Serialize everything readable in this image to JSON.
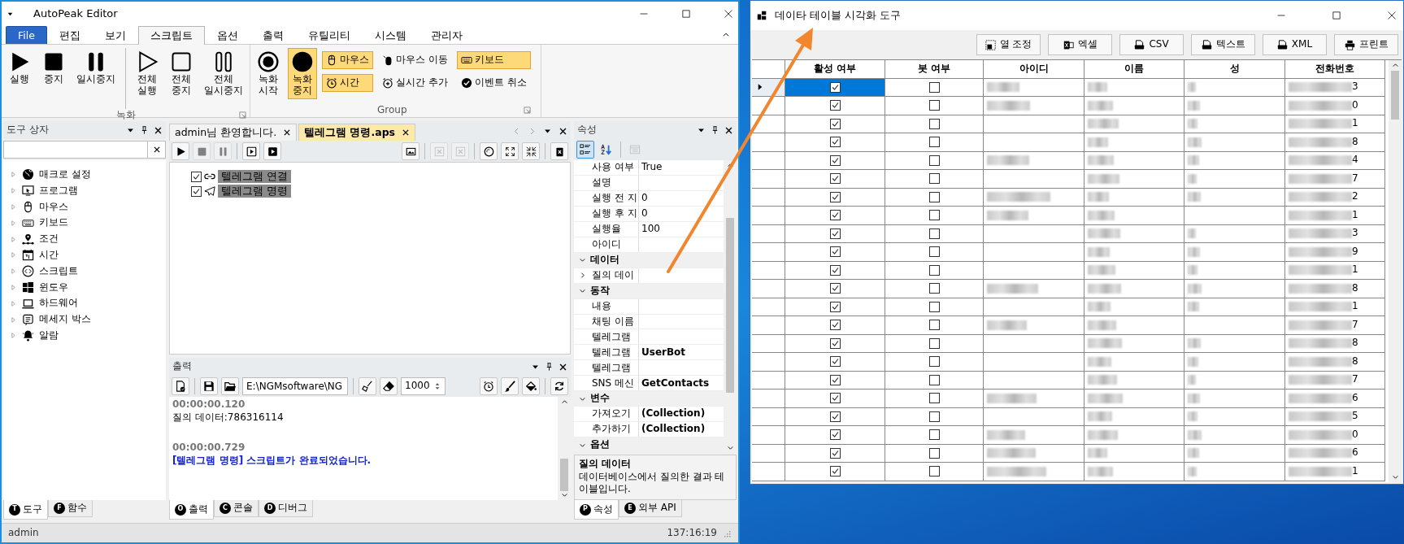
{
  "editor": {
    "title": "AutoPeak Editor",
    "menu_tabs": [
      {
        "label": "File",
        "kind": "file",
        "selected": false
      },
      {
        "label": "편집",
        "kind": "tab",
        "selected": false
      },
      {
        "label": "보기",
        "kind": "tab",
        "selected": false
      },
      {
        "label": "스크립트",
        "kind": "tab",
        "selected": true
      },
      {
        "label": "옵션",
        "kind": "tab",
        "selected": false
      },
      {
        "label": "출력",
        "kind": "tab",
        "selected": false
      },
      {
        "label": "유틸리티",
        "kind": "tab",
        "selected": false
      },
      {
        "label": "시스템",
        "kind": "tab",
        "selected": false
      },
      {
        "label": "관리자",
        "kind": "tab",
        "selected": false
      }
    ],
    "ribbon_groups": [
      {
        "label": "녹화",
        "buttons": [
          {
            "label": "실행",
            "on": false
          },
          {
            "label": "중지",
            "on": false
          },
          {
            "label": "일시중지",
            "on": false
          },
          {
            "label": "전체 실행",
            "on": false
          },
          {
            "label": "전체 중지",
            "on": false
          },
          {
            "label": "전체 일시중지",
            "on": false
          }
        ]
      },
      {
        "label": "Group",
        "buttons": [
          {
            "label": "녹화 시작",
            "on": false
          },
          {
            "label": "녹화 중지",
            "on": true
          }
        ],
        "small_buttons": [
          {
            "label": "마우스",
            "on": true
          },
          {
            "label": "마우스 이동",
            "on": false
          },
          {
            "label": "키보드",
            "on": true
          },
          {
            "label": "시간",
            "on": true
          },
          {
            "label": "실시간 추가",
            "on": false
          },
          {
            "label": "이벤트 취소",
            "on": false
          }
        ]
      }
    ],
    "toolbox": {
      "title": "도구 상자",
      "items": [
        {
          "label": "매크로 설정",
          "expanded": false
        },
        {
          "label": "프로그램",
          "expanded": false
        },
        {
          "label": "마우스",
          "expanded": false
        },
        {
          "label": "키보드",
          "expanded": false
        },
        {
          "label": "조건",
          "expanded": false
        },
        {
          "label": "시간",
          "expanded": false
        },
        {
          "label": "스크립트",
          "expanded": false
        },
        {
          "label": "윈도우",
          "expanded": false
        },
        {
          "label": "하드웨어",
          "expanded": false
        },
        {
          "label": "메세지 박스",
          "expanded": false
        },
        {
          "label": "알람",
          "expanded": false
        }
      ],
      "tabs": [
        {
          "key": "T",
          "label": "도구",
          "selected": true
        },
        {
          "key": "F",
          "label": "함수",
          "selected": false
        }
      ]
    },
    "document": {
      "tabs": [
        {
          "label": "admin님 환영합니다.",
          "selected": false
        },
        {
          "label": "텔레그램 명령.aps",
          "selected": true
        }
      ],
      "toolbar": [
        {
          "disabled": false
        },
        {
          "disabled": true
        },
        {
          "disabled": true
        },
        {
          "disabled": false
        },
        {
          "disabled": false
        },
        {
          "disabled": false
        },
        {
          "disabled": true
        },
        {
          "disabled": true
        },
        {
          "disabled": false
        },
        {
          "disabled": false
        },
        {
          "disabled": false
        },
        {
          "disabled": false
        }
      ],
      "items": [
        {
          "label": "텔레그램 연결",
          "checked": true
        },
        {
          "label": "텔레그램 명령",
          "checked": true
        }
      ]
    },
    "output": {
      "title": "출력",
      "path": "E:\\NGMsoftware\\NG",
      "count": "1000",
      "log": [
        {
          "kind": "time",
          "text": "00:00:00.120"
        },
        {
          "kind": "text",
          "text": "질의 데이터:786316114"
        },
        {
          "kind": "time",
          "text": "00:00:00.729"
        },
        {
          "kind": "notice",
          "text": "[텔레그램 명령] 스크립트가 완료되었습니다."
        }
      ],
      "tabs": [
        {
          "key": "O",
          "label": "출력",
          "selected": true
        },
        {
          "key": "C",
          "label": "콘솔",
          "selected": false
        },
        {
          "key": "D",
          "label": "디버그",
          "selected": false
        }
      ]
    },
    "properties": {
      "title": "속성",
      "toolbar": [
        {
          "selected": true,
          "disabled": false
        },
        {
          "selected": false,
          "disabled": false
        },
        {
          "selected": false,
          "disabled": true
        }
      ],
      "rows": [
        {
          "kind": "property",
          "name": "사용 여부",
          "value": "True",
          "modified": false
        },
        {
          "kind": "property",
          "name": "설명"
        },
        {
          "kind": "property",
          "name": "실행 전 지",
          "value": "0",
          "modified": false
        },
        {
          "kind": "property",
          "name": "실행 후 지",
          "value": "0",
          "modified": false
        },
        {
          "kind": "property",
          "name": "실행율",
          "value": "100",
          "modified": false
        },
        {
          "kind": "property",
          "name": "아이디"
        },
        {
          "kind": "category",
          "label": "데이터",
          "expanded": true
        },
        {
          "kind": "property",
          "name": "질의 데이",
          "expanded": false
        },
        {
          "kind": "category",
          "label": "동작",
          "expanded": true
        },
        {
          "kind": "property",
          "name": "내용"
        },
        {
          "kind": "property",
          "name": "채팅 이름"
        },
        {
          "kind": "property",
          "name": "텔레그램"
        },
        {
          "kind": "property",
          "name": "텔레그램",
          "value": "UserBot",
          "modified": true
        },
        {
          "kind": "property",
          "name": "텔레그램"
        },
        {
          "kind": "property",
          "name": "SNS 메신",
          "value": "GetContacts",
          "modified": true
        },
        {
          "kind": "category",
          "label": "변수",
          "expanded": true
        },
        {
          "kind": "property",
          "name": "가져오기",
          "value": "(Collection)",
          "modified": true
        },
        {
          "kind": "property",
          "name": "추가하기",
          "value": "(Collection)",
          "modified": true
        },
        {
          "kind": "category",
          "label": "옵션",
          "expanded": true
        }
      ],
      "description": {
        "title": "질의 데이터",
        "text": "데이터베이스에서 질의한 결과 테이블입니다."
      },
      "tabs": [
        {
          "key": "P",
          "label": "속성",
          "selected": true
        },
        {
          "key": "E",
          "label": "외부 API",
          "selected": false
        }
      ]
    },
    "status_bar": {
      "user": "admin",
      "time": "137:16:19"
    }
  },
  "viewer": {
    "title": "데이타 테이블 시각화 도구",
    "buttons": [
      "열 조정",
      "엑셀",
      "CSV",
      "텍스트",
      "XML",
      "프린트"
    ],
    "columns": [
      "활성 여부",
      "봇 여부",
      "아이디",
      "이름",
      "성",
      "전화번호"
    ],
    "rows": [
      {
        "selected": true,
        "active": true,
        "bot": false,
        "id_shown": true,
        "surname_shown": true,
        "phone_end": "3"
      },
      {
        "selected": false,
        "active": true,
        "bot": false,
        "id_shown": true,
        "surname_shown": true,
        "phone_end": "0"
      },
      {
        "selected": false,
        "active": true,
        "bot": false,
        "id_shown": false,
        "surname_shown": true,
        "phone_end": "1"
      },
      {
        "selected": false,
        "active": true,
        "bot": false,
        "id_shown": false,
        "surname_shown": true,
        "phone_end": "8"
      },
      {
        "selected": false,
        "active": true,
        "bot": false,
        "id_shown": true,
        "surname_shown": true,
        "phone_end": "4"
      },
      {
        "selected": false,
        "active": true,
        "bot": false,
        "id_shown": false,
        "surname_shown": true,
        "phone_end": "7"
      },
      {
        "selected": false,
        "active": true,
        "bot": false,
        "id_shown": true,
        "surname_shown": true,
        "phone_end": "2"
      },
      {
        "selected": false,
        "active": true,
        "bot": false,
        "id_shown": true,
        "surname_shown": false,
        "phone_end": "1"
      },
      {
        "selected": false,
        "active": true,
        "bot": false,
        "id_shown": false,
        "surname_shown": true,
        "phone_end": "3"
      },
      {
        "selected": false,
        "active": true,
        "bot": false,
        "id_shown": false,
        "surname_shown": true,
        "phone_end": "9"
      },
      {
        "selected": false,
        "active": true,
        "bot": false,
        "id_shown": false,
        "surname_shown": true,
        "phone_end": "1"
      },
      {
        "selected": false,
        "active": true,
        "bot": false,
        "id_shown": true,
        "surname_shown": true,
        "phone_end": "8"
      },
      {
        "selected": false,
        "active": true,
        "bot": false,
        "id_shown": false,
        "surname_shown": true,
        "phone_end": "1"
      },
      {
        "selected": false,
        "active": true,
        "bot": false,
        "id_shown": true,
        "surname_shown": false,
        "phone_end": "7"
      },
      {
        "selected": false,
        "active": true,
        "bot": false,
        "id_shown": false,
        "surname_shown": true,
        "phone_end": "8"
      },
      {
        "selected": false,
        "active": true,
        "bot": false,
        "id_shown": false,
        "surname_shown": true,
        "phone_end": "8"
      },
      {
        "selected": false,
        "active": true,
        "bot": false,
        "id_shown": false,
        "surname_shown": true,
        "phone_end": "7"
      },
      {
        "selected": false,
        "active": true,
        "bot": false,
        "id_shown": true,
        "surname_shown": true,
        "phone_end": "6"
      },
      {
        "selected": false,
        "active": true,
        "bot": false,
        "id_shown": false,
        "surname_shown": true,
        "phone_end": "5"
      },
      {
        "selected": false,
        "active": true,
        "bot": false,
        "id_shown": true,
        "surname_shown": true,
        "phone_end": "0"
      },
      {
        "selected": false,
        "active": true,
        "bot": false,
        "id_shown": true,
        "surname_shown": true,
        "phone_end": "6"
      },
      {
        "selected": false,
        "active": true,
        "bot": false,
        "id_shown": true,
        "surname_shown": true,
        "phone_end": "1"
      }
    ]
  }
}
